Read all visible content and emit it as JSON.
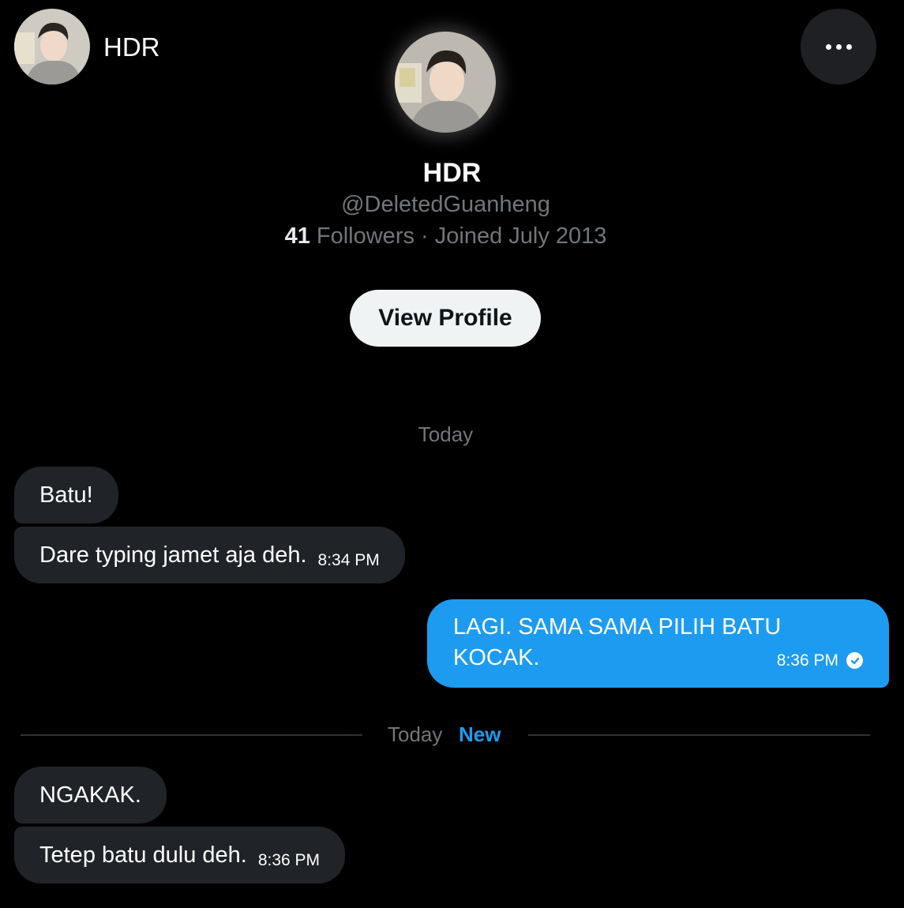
{
  "header": {
    "name": "HDR"
  },
  "profile": {
    "name": "HDR",
    "handle": "@DeletedGuanheng",
    "followers_count": "41",
    "followers_label": " Followers",
    "joined": " · Joined July 2013",
    "view_profile_label": "View Profile"
  },
  "conversation": {
    "date_label": "Today",
    "messages_first": [
      {
        "text": "Batu!",
        "time": ""
      },
      {
        "text": "Dare typing jamet aja deh.",
        "time": "8:34 PM"
      }
    ],
    "outgoing": {
      "line1": "LAGI. SAMA SAMA PILIH BATU",
      "line2": "KOCAK.",
      "time": "8:36 PM",
      "status_icon": "seen-check-icon"
    },
    "separator": {
      "today": "Today",
      "new": "New"
    },
    "messages_second": [
      {
        "text": "NGAKAK.",
        "time": ""
      },
      {
        "text": "Tetep batu dulu deh.",
        "time": "8:36 PM"
      }
    ]
  },
  "colors": {
    "background": "#000000",
    "incoming_bubble": "#202327",
    "outgoing_bubble": "#1d9bf0",
    "accent": "#1d9bf0",
    "muted_text": "#71767b"
  }
}
